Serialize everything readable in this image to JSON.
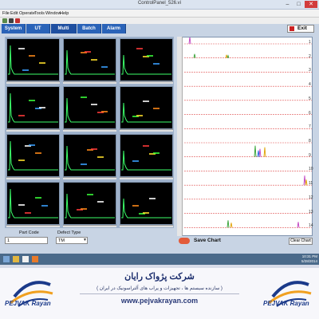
{
  "window": {
    "title": "ControlPanel_526.vi",
    "controls": {
      "minimize": "–",
      "maximize": "□",
      "close": "✕"
    }
  },
  "menu": [
    "File",
    "Edit",
    "Operate",
    "Tools",
    "Window",
    "Help"
  ],
  "tabs": [
    {
      "label": "System",
      "active": false
    },
    {
      "label": "UT",
      "active": false
    },
    {
      "label": "Multi",
      "active": true
    },
    {
      "label": "Batch",
      "active": false
    },
    {
      "label": "Alarm",
      "active": false
    }
  ],
  "exit_label": "Exit",
  "strip_chart": {
    "row_labels": [
      "1",
      "2",
      "3",
      "4",
      "5",
      "6",
      "7",
      "8",
      "9",
      "10",
      "11",
      "12",
      "13",
      "14"
    ],
    "gridline_color": "#e05050",
    "trace_colors": [
      "#c040c0",
      "#e0a000",
      "#30a030",
      "#2060e0"
    ]
  },
  "controls": {
    "part_code_label": "Part Code",
    "part_code_value": "1",
    "defect_type_label": "Defect Type",
    "defect_type_value": "TM",
    "save_chart_label": "Save Chart",
    "clear_chart_label": "Clear Chart"
  },
  "taskbar": {
    "time": "10:31 PM",
    "date": "5/28/2014"
  },
  "banner": {
    "company_fa": "شرکت پژواک رایان",
    "tagline_fa": "( سازنده سیستم ها ، تجهیزات و پراب های آلتراسونیک در ایران )",
    "website": "www.pejvakrayan.com",
    "logo_text": "PEJVAK Rayan",
    "brand_color": "#1b3a8a"
  },
  "colors": {
    "tab_bg": "#2a63b8",
    "scope_bg": "#000000",
    "gate_colors": [
      "#ffffff",
      "#ff8a1a",
      "#ffe02a",
      "#3aa0ff",
      "#ff3a3a",
      "#3aff3a"
    ]
  }
}
